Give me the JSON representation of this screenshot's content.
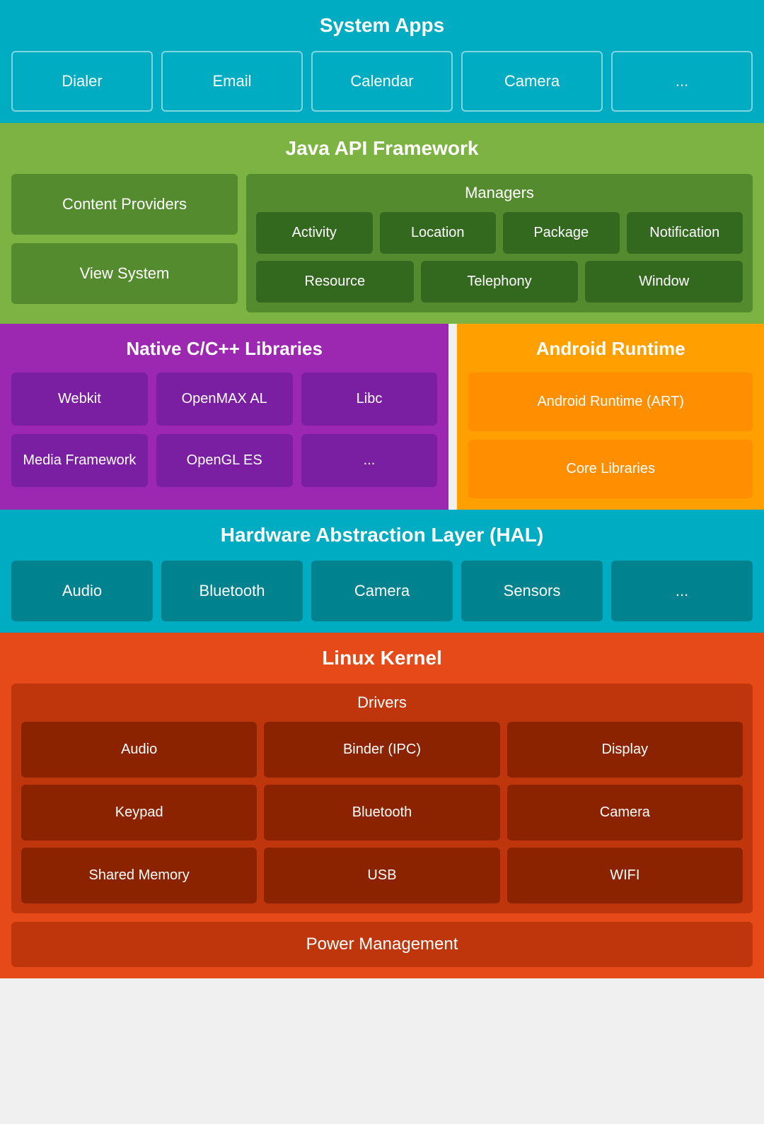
{
  "system_apps": {
    "title": "System Apps",
    "apps": [
      "Dialer",
      "Email",
      "Calendar",
      "Camera",
      "..."
    ]
  },
  "java_api": {
    "title": "Java API Framework",
    "left": [
      "Content Providers",
      "View System"
    ],
    "managers": {
      "title": "Managers",
      "row1": [
        "Activity",
        "Location",
        "Package",
        "Notification"
      ],
      "row2": [
        "Resource",
        "Telephony",
        "Window"
      ]
    }
  },
  "native": {
    "title": "Native C/C++ Libraries",
    "row1": [
      "Webkit",
      "OpenMAX AL",
      "Libc"
    ],
    "row2": [
      "Media Framework",
      "OpenGL ES",
      "..."
    ]
  },
  "android_runtime": {
    "title": "Android Runtime",
    "row1": "Android Runtime (ART)",
    "row2": "Core Libraries"
  },
  "hal": {
    "title": "Hardware Abstraction Layer (HAL)",
    "items": [
      "Audio",
      "Bluetooth",
      "Camera",
      "Sensors",
      "..."
    ]
  },
  "linux": {
    "title": "Linux Kernel",
    "drivers": {
      "title": "Drivers",
      "row1": [
        "Audio",
        "Binder (IPC)",
        "Display"
      ],
      "row2": [
        "Keypad",
        "Bluetooth",
        "Camera"
      ],
      "row3": [
        "Shared Memory",
        "USB",
        "WIFI"
      ]
    },
    "power": "Power Management"
  }
}
